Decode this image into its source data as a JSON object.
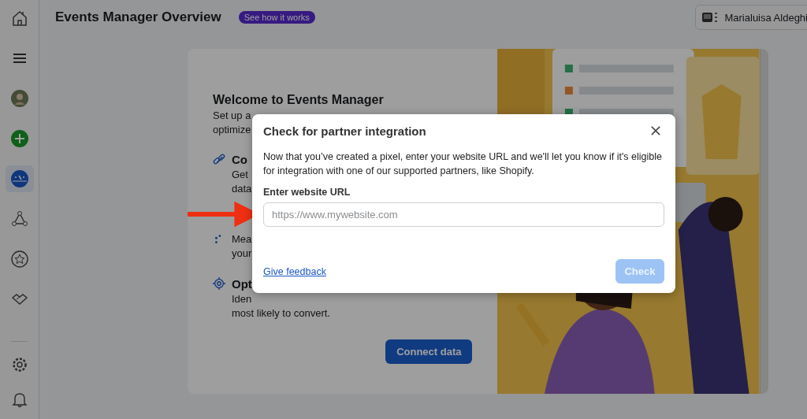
{
  "sidebar": {
    "items": [
      {
        "kind": "home",
        "selected": false
      },
      {
        "kind": "menu",
        "selected": false
      },
      {
        "kind": "avatar",
        "selected": false
      },
      {
        "kind": "add",
        "selected": false
      },
      {
        "kind": "gauge",
        "selected": true
      },
      {
        "kind": "nodes",
        "selected": false
      },
      {
        "kind": "star",
        "selected": false
      },
      {
        "kind": "handshake",
        "selected": false
      }
    ],
    "bottom": [
      {
        "kind": "settings"
      },
      {
        "kind": "bell"
      }
    ]
  },
  "header": {
    "title": "Events Manager Overview",
    "badge": "See how it works",
    "account": "Marialuisa Aldeghi"
  },
  "card": {
    "title": "Welcome to Events Manager",
    "intro": [
      "Set up a",
      "optimize"
    ],
    "features": [
      {
        "kind": "link",
        "title": "Co",
        "lines": [
          "Get",
          "data"
        ]
      },
      {
        "kind": "measure",
        "lines": [
          "Mea",
          "your"
        ]
      },
      {
        "kind": "target",
        "title": "Opt",
        "lines": [
          "Iden",
          "most likely to convert."
        ]
      }
    ],
    "button": "Connect data"
  },
  "dialog": {
    "title": "Check for partner integration",
    "body": "Now that you’ve created a pixel, enter your website URL and we'll let you know if it's eligible for integration with one of our supported partners, like Shopify.",
    "field_label": "Enter website URL",
    "placeholder": "https://www.mywebsite.com",
    "link": "Give feedback",
    "button": {
      "label": "Check",
      "disabled": true
    }
  }
}
